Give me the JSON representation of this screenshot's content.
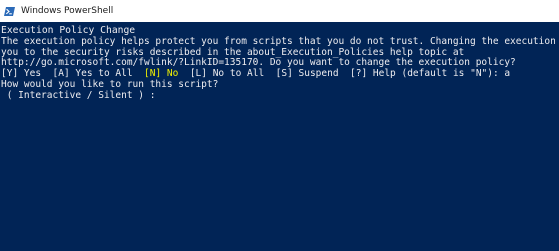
{
  "window": {
    "title": "Windows PowerShell",
    "icon": "powershell-icon",
    "background": "#012456"
  },
  "console": {
    "heading": "Execution Policy Change",
    "message_lines": [
      "The execution policy helps protect you from scripts that you do not trust. Changing the execution",
      "you to the security risks described in the about_Execution_Policies help topic at",
      "http://go.microsoft.com/fwlink/?LinkID=135170. Do you want to change the execution policy?"
    ],
    "choices": {
      "yes": "[Y] Yes",
      "yes_to_all": "[A] Yes to All",
      "no_default": "[N] No",
      "no_to_all": "[L] No to All",
      "suspend": "[S] Suspend",
      "help": "[?] Help (default is \"N\"): a"
    },
    "default_choice_color": "#f2f200",
    "question": "How would you like to run this script?",
    "prompt": " ( Interactive / Silent ) :"
  }
}
